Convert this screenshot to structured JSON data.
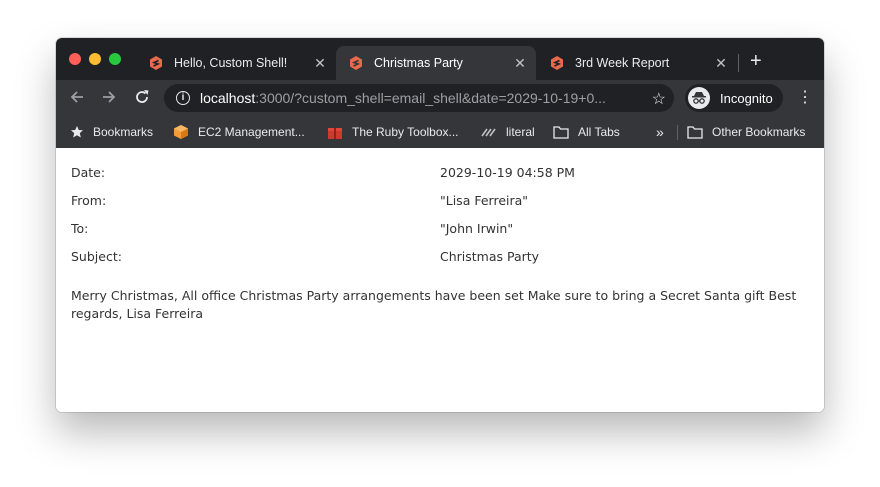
{
  "browser": {
    "tabs": [
      {
        "title": "Hello, Custom Shell!",
        "close": "✕",
        "active": false
      },
      {
        "title": "Christmas Party",
        "close": "✕",
        "active": true
      },
      {
        "title": "3rd Week Report",
        "close": "✕",
        "active": false
      }
    ],
    "new_tab": "+",
    "address": {
      "host": "localhost",
      "rest": ":3000/?custom_shell=email_shell&date=2029-10-19+0..."
    },
    "profile_label": "Incognito",
    "bookmarks": [
      {
        "label": "Bookmarks",
        "icon": "star-icon"
      },
      {
        "label": "EC2 Management...",
        "icon": "aws-cube-icon"
      },
      {
        "label": "The Ruby Toolbox...",
        "icon": "gift-icon"
      },
      {
        "label": "literal",
        "icon": "literal-icon"
      },
      {
        "label": "All Tabs",
        "icon": "folder-icon"
      }
    ],
    "overflow": "»",
    "other_bookmarks": "Other Bookmarks"
  },
  "email": {
    "headers": [
      {
        "label": "Date:",
        "value": "2029-10-19 04:58 PM"
      },
      {
        "label": "From:",
        "value": "\"Lisa Ferreira\""
      },
      {
        "label": "To:",
        "value": "\"John Irwin\""
      },
      {
        "label": "Subject:",
        "value": "Christmas Party"
      }
    ],
    "body": "Merry Christmas, All office Christmas Party arrangements have been set Make sure to bring a Secret Santa gift Best regards, Lisa Ferreira"
  },
  "colors": {
    "favicon": "#e8694b",
    "chrome_dark": "#202124",
    "chrome_toolbar": "#35363a"
  }
}
